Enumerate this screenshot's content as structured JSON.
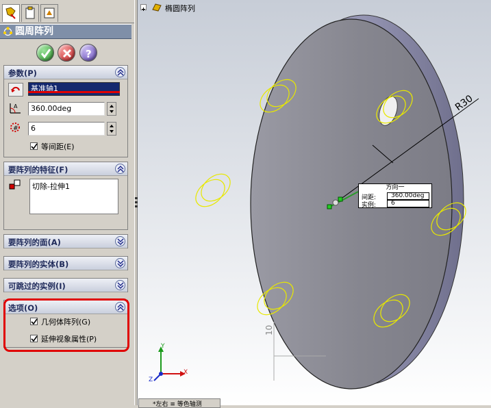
{
  "feature_title": "圆周阵列",
  "actions": {
    "ok": "ok-check",
    "cancel": "cancel-x",
    "help": "help-question"
  },
  "parameters": {
    "title": "参数(P)",
    "axis": "基准轴1",
    "angle": "360.00deg",
    "instances": "6",
    "equal_spacing_label": "等间距(E)",
    "equal_spacing_checked": true
  },
  "features_to_pattern": {
    "title": "要阵列的特征(F)",
    "items": [
      "切除-拉伸1"
    ]
  },
  "faces_to_pattern": {
    "title": "要阵列的面(A)"
  },
  "bodies_to_pattern": {
    "title": "要阵列的实体(B)"
  },
  "instances_to_skip": {
    "title": "可跳过的实例(I)"
  },
  "options": {
    "title": "选项(O)",
    "geometry_pattern_label": "几何体阵列(G)",
    "propagate_visual_label": "延伸视象属性(P)",
    "geometry_pattern_checked": true,
    "propagate_visual_checked": true
  },
  "tree": {
    "item": "椭圆阵列"
  },
  "callout": {
    "header": "方向一",
    "spacing_label": "间距:",
    "spacing_value": "360.00deg",
    "instances_label": "实例:",
    "instances_value": "6"
  },
  "dimensions": {
    "radius": "R30",
    "thickness": "10"
  },
  "triad": {
    "x": "X",
    "y": "Y",
    "z": "Z"
  },
  "bottom_tab": "*左右 ≡ 等色轴测",
  "colors": {
    "highlight": "#e00000",
    "preview": "#e8e800",
    "disk": "#8e8e9a"
  }
}
